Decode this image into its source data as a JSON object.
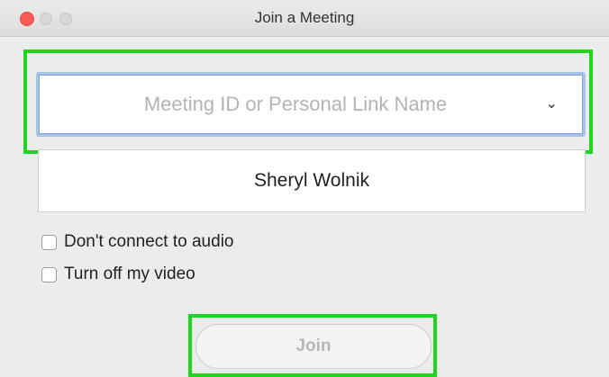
{
  "window": {
    "title": "Join a Meeting"
  },
  "meeting_field": {
    "placeholder": "Meeting ID or Personal Link Name",
    "value": ""
  },
  "name_field": {
    "value": "Sheryl Wolnik"
  },
  "options": [
    {
      "label": "Don't connect to audio",
      "checked": false
    },
    {
      "label": "Turn off my video",
      "checked": false
    }
  ],
  "join_button": {
    "label": "Join",
    "enabled": false
  },
  "colors": {
    "highlight": "#1fd51f",
    "close_button": "#fc5b57",
    "focus_ring": "#a7c4e6"
  }
}
